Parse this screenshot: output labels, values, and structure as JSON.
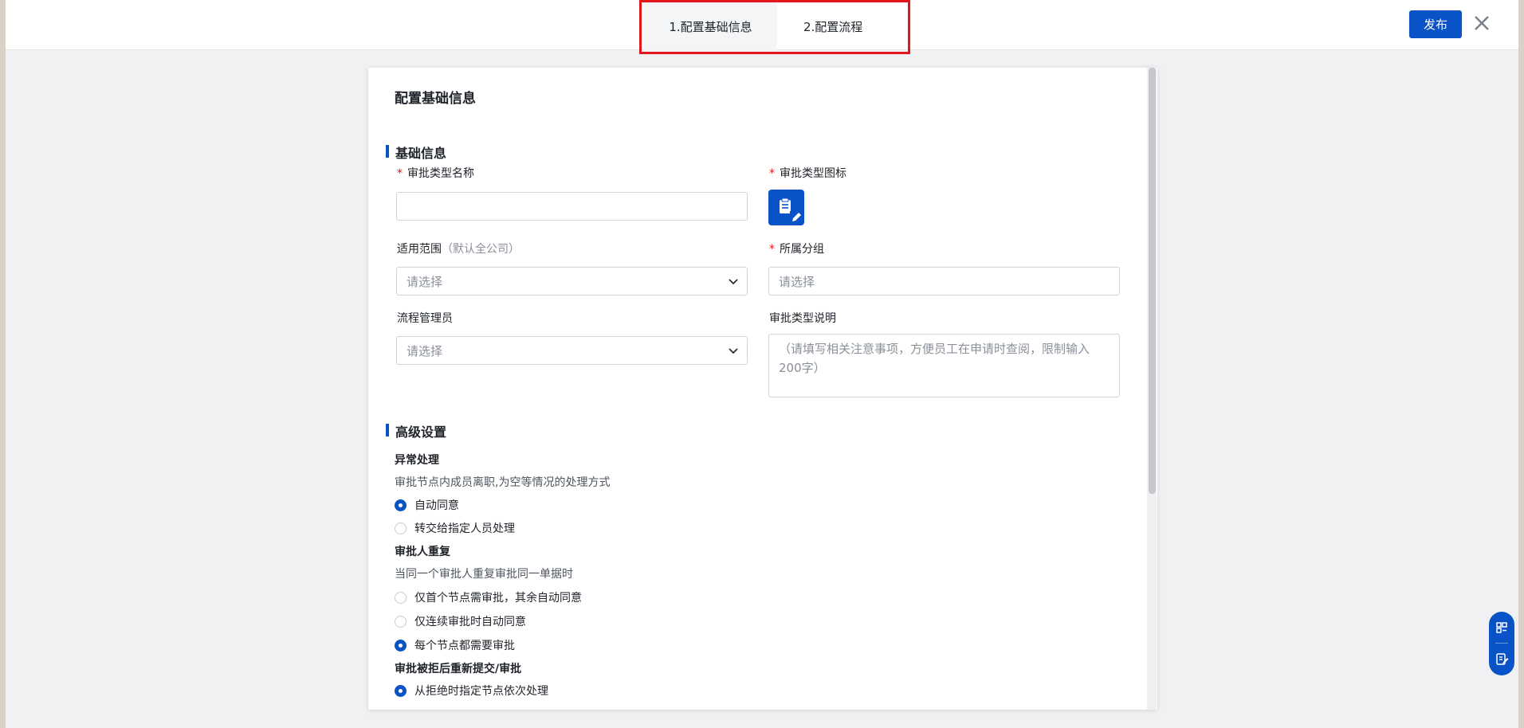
{
  "header": {
    "tabs": [
      {
        "label": "1.配置基础信息",
        "active": true
      },
      {
        "label": "2.配置流程",
        "active": false
      }
    ],
    "publish_label": "发布",
    "close_icon": "close-icon"
  },
  "panel": {
    "title": "配置基础信息",
    "basic": {
      "section_title": "基础信息",
      "name_label": "审批类型名称",
      "name_value": "",
      "icon_label": "审批类型图标",
      "icon_name": "form-edit-icon",
      "scope_label": "适用范围",
      "scope_hint": "（默认全公司）",
      "scope_placeholder": "请选择",
      "group_label": "所属分组",
      "group_placeholder": "请选择",
      "admin_label": "流程管理员",
      "admin_placeholder": "请选择",
      "desc_label": "审批类型说明",
      "desc_placeholder": "（请填写相关注意事项，方便员工在申请时查阅，限制输入200字）"
    },
    "advanced": {
      "section_title": "高级设置",
      "exception": {
        "title": "异常处理",
        "desc": "审批节点内成员离职,为空等情况的处理方式",
        "options": [
          {
            "label": "自动同意",
            "selected": true
          },
          {
            "label": "转交给指定人员处理",
            "selected": false
          }
        ]
      },
      "repeat": {
        "title": "审批人重复",
        "desc": "当同一个审批人重复审批同一单据时",
        "options": [
          {
            "label": "仅首个节点需审批，其余自动同意",
            "selected": false
          },
          {
            "label": "仅连续审批时自动同意",
            "selected": false
          },
          {
            "label": "每个节点都需要审批",
            "selected": true
          }
        ]
      },
      "rejected": {
        "title": "审批被拒后重新提交/审批",
        "options": [
          {
            "label": "从拒绝时指定节点依次处理",
            "selected": true
          }
        ]
      }
    }
  },
  "side_float": {
    "icons": [
      "flow-icon",
      "edit-note-icon"
    ]
  }
}
